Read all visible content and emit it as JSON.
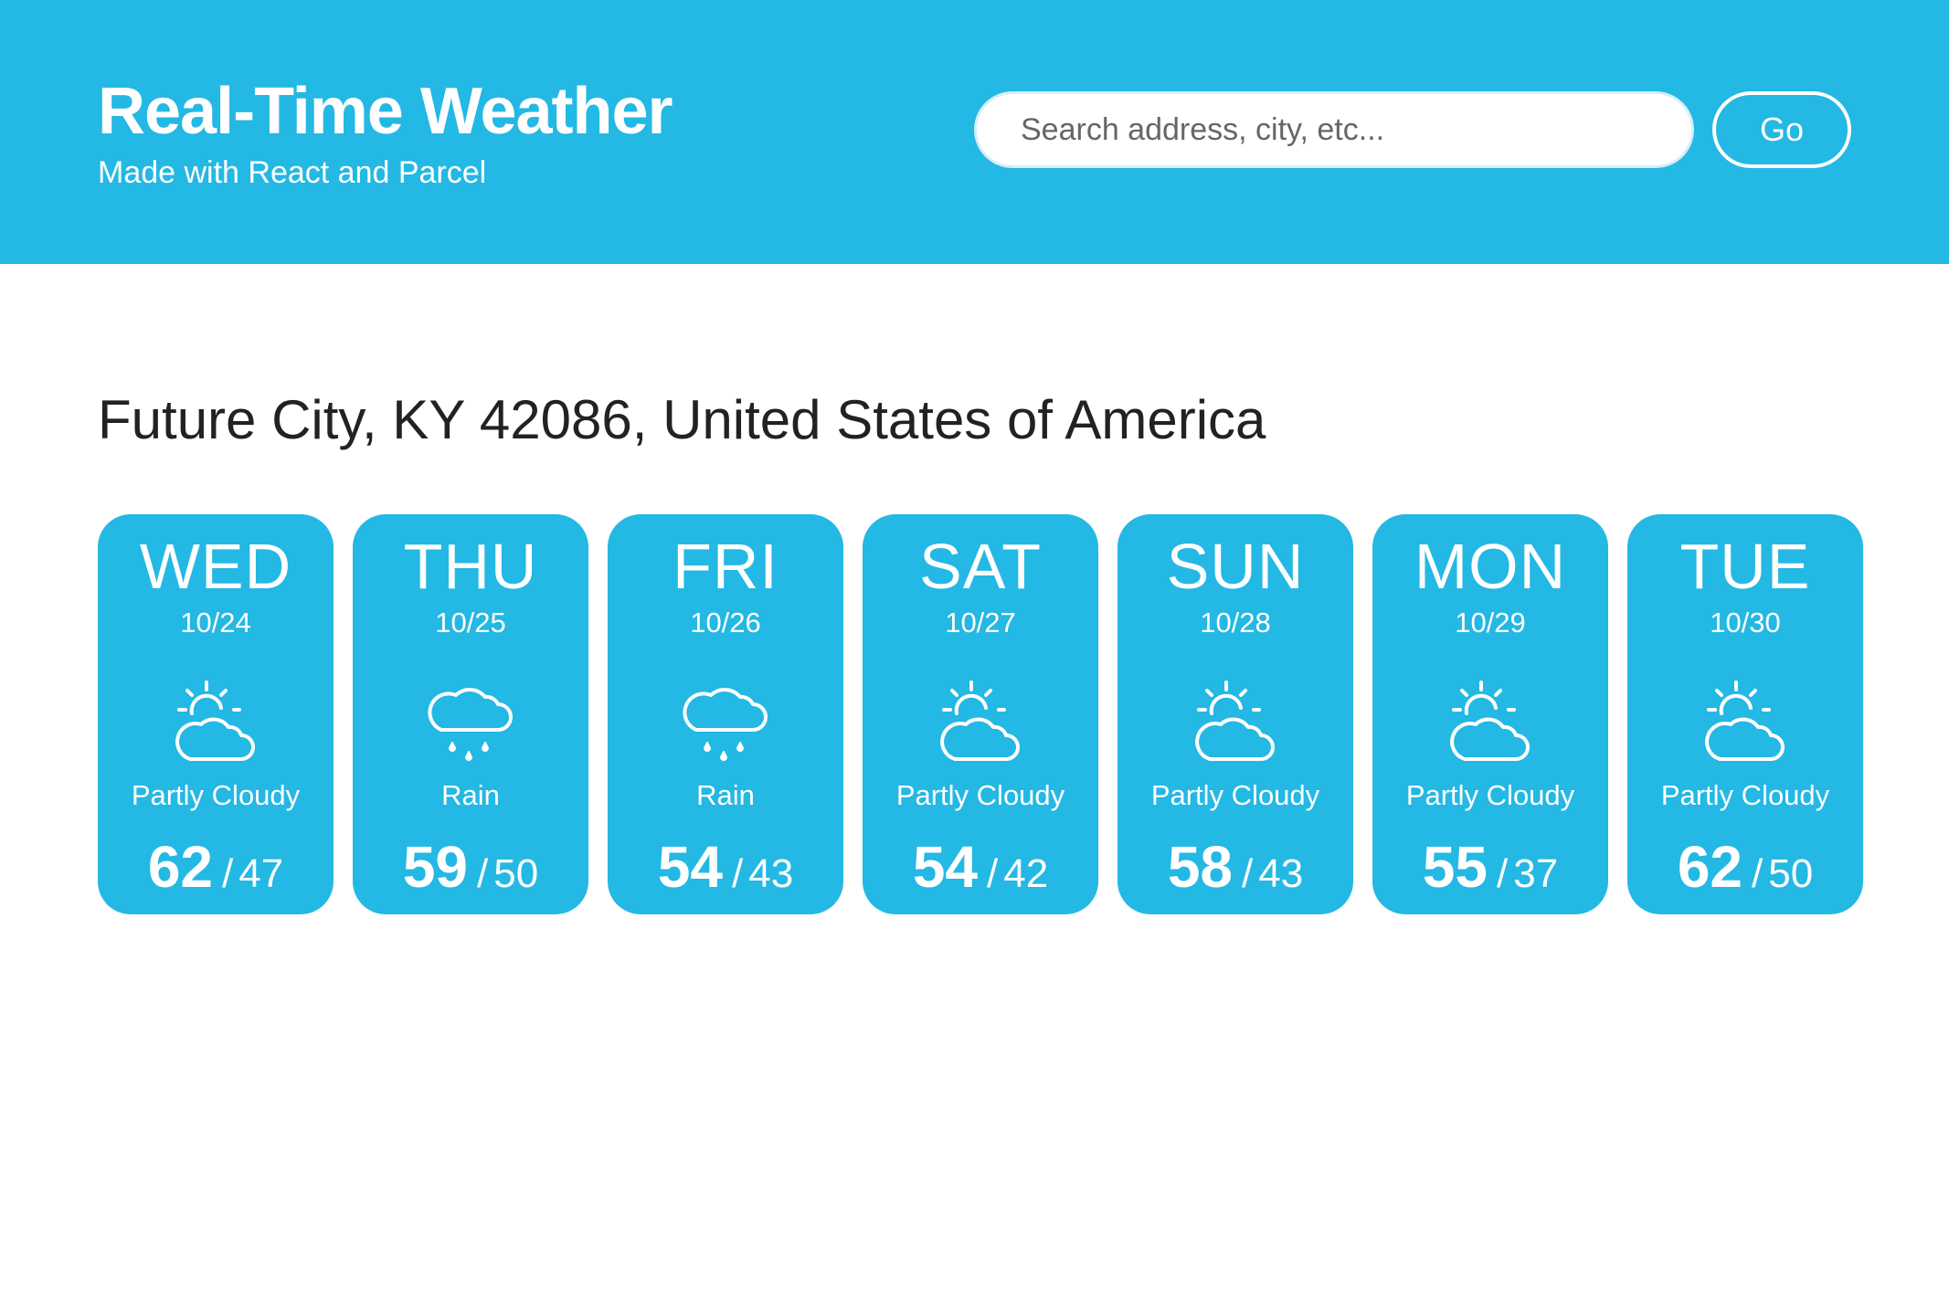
{
  "header": {
    "title": "Real-Time Weather",
    "subtitle": "Made with React and Parcel",
    "search_placeholder": "Search address, city, etc...",
    "search_value": "",
    "go_label": "Go"
  },
  "colors": {
    "accent": "#24b8e4",
    "background": "#ffffff",
    "text": "#222222"
  },
  "location": "Future City, KY 42086, United States of America",
  "forecast": [
    {
      "day": "WED",
      "date": "10/24",
      "icon": "partly-cloudy-icon",
      "condition": "Partly Cloudy",
      "high": "62",
      "low": "47"
    },
    {
      "day": "THU",
      "date": "10/25",
      "icon": "rain-icon",
      "condition": "Rain",
      "high": "59",
      "low": "50"
    },
    {
      "day": "FRI",
      "date": "10/26",
      "icon": "rain-icon",
      "condition": "Rain",
      "high": "54",
      "low": "43"
    },
    {
      "day": "SAT",
      "date": "10/27",
      "icon": "partly-cloudy-icon",
      "condition": "Partly Cloudy",
      "high": "54",
      "low": "42"
    },
    {
      "day": "SUN",
      "date": "10/28",
      "icon": "partly-cloudy-icon",
      "condition": "Partly Cloudy",
      "high": "58",
      "low": "43"
    },
    {
      "day": "MON",
      "date": "10/29",
      "icon": "partly-cloudy-icon",
      "condition": "Partly Cloudy",
      "high": "55",
      "low": "37"
    },
    {
      "day": "TUE",
      "date": "10/30",
      "icon": "partly-cloudy-icon",
      "condition": "Partly Cloudy",
      "high": "62",
      "low": "50"
    }
  ]
}
